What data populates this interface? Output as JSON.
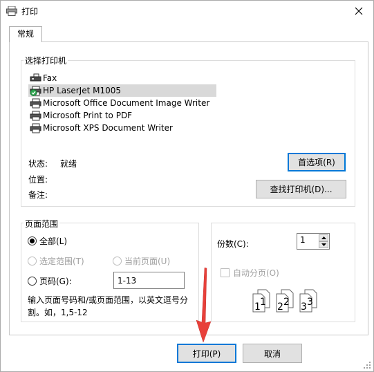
{
  "window": {
    "title": "打印"
  },
  "tabs": [
    {
      "label": "常规"
    }
  ],
  "printer_group": {
    "title": "选择打印机",
    "printers": [
      {
        "name": "Fax",
        "icon": "fax-printer-icon",
        "selected": false
      },
      {
        "name": "HP LaserJet M1005",
        "icon": "default-printer-icon",
        "selected": true
      },
      {
        "name": "Microsoft Office Document Image Writer",
        "icon": "printer-icon",
        "selected": false
      },
      {
        "name": "Microsoft Print to PDF",
        "icon": "printer-icon",
        "selected": false
      },
      {
        "name": "Microsoft XPS Document Writer",
        "icon": "printer-icon",
        "selected": false
      }
    ],
    "status_label": "状态:",
    "status_value": "就绪",
    "location_label": "位置:",
    "comment_label": "备注:",
    "preferences_button": "首选项(R)",
    "find_printer_button": "查找打印机(D)..."
  },
  "page_range": {
    "title": "页面范围",
    "all_label": "全部(L)",
    "selection_label": "选定范围(T)",
    "current_page_label": "当前页面(U)",
    "pages_label": "页码(G):",
    "pages_value": "1-13",
    "help_line1": "输入页面号码和/或页面范围，以英文逗号分",
    "help_line2": "割。如，1,5-12"
  },
  "copies": {
    "label": "份数(C):",
    "value": "1",
    "collate_label": "自动分页(O)",
    "collate_pages": [
      "1",
      "1",
      "2",
      "2",
      "3",
      "3"
    ]
  },
  "footer": {
    "print_button": "打印(P)",
    "cancel_button": "取消"
  },
  "colors": {
    "accent": "#0078d7",
    "selected_bg": "#d9d9d9",
    "arrow": "#e8403a"
  }
}
